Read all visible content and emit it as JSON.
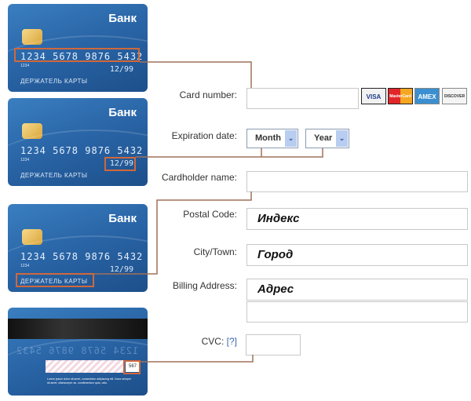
{
  "cards": {
    "bank_name": "Банк",
    "number": "1234 5678 9876 5432",
    "small_number": "1234",
    "expiry": "12/99",
    "holder": "ДЕРЖАТЕЛЬ КАРТЫ",
    "back_number": "1234 5678 9876 5432",
    "cvc": "567",
    "fine_print": "Lorem ipsum dolor sit amet, consectetur adipiscing elit. Nunc semper sit amet, ullamcorper ac, condimentum quis, odio."
  },
  "form": {
    "card_number": {
      "label": "Card number:",
      "value": ""
    },
    "card_logos": [
      "VISA",
      "MasterCard",
      "AMEX",
      "DISCOVER"
    ],
    "expiration": {
      "label": "Expiration date:",
      "month": "Month",
      "year": "Year"
    },
    "cardholder": {
      "label": "Cardholder name:",
      "value": ""
    },
    "postal": {
      "label": "Postal Code:",
      "value": "Индекс"
    },
    "city": {
      "label": "City/Town:",
      "value": "Город"
    },
    "billing": {
      "label": "Billing Address:",
      "value": "Адрес",
      "value2": ""
    },
    "cvc": {
      "label": "CVC:",
      "help": "[?]",
      "value": ""
    }
  },
  "colors": {
    "connector": "#a0705a",
    "highlight": "#d0683c",
    "card": "#2a66a8"
  }
}
